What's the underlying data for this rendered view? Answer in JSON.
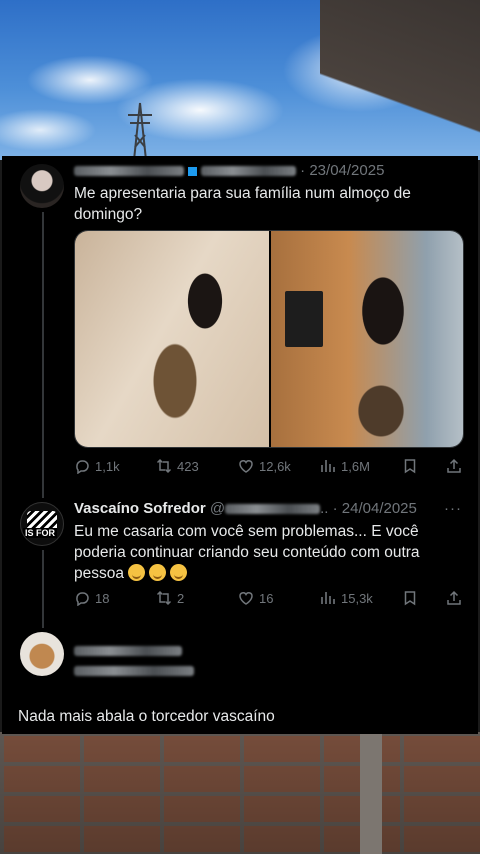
{
  "tweet1": {
    "date": "23/04/2025",
    "text": "Me apresentaria para sua família num almoço de domingo?",
    "stats": {
      "replies": "1,1k",
      "retweets": "423",
      "likes": "12,6k",
      "views": "1,6M"
    }
  },
  "tweet2": {
    "display_name": "Vascaíno Sofredor",
    "handle_fragment": "@",
    "date": "24/04/2025",
    "text": "Eu me casaria com você sem problemas... E você poderia continuar criando seu conteúdo com outra pessoa",
    "stats": {
      "replies": "18",
      "retweets": "2",
      "likes": "16",
      "views": "15,3k"
    }
  },
  "tweet3": {
    "text": "Nada mais abala o torcedor vascaíno"
  },
  "colors": {
    "background": "#000000",
    "text": "#e7e9ea",
    "muted": "#71767b",
    "verified": "#1d9bf0"
  }
}
